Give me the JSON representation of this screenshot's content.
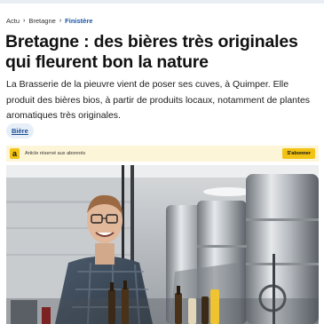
{
  "breadcrumb": {
    "items": [
      "Actu",
      "Bretagne",
      "Finistère"
    ]
  },
  "article": {
    "title": "Bretagne : des bières très originales qui fleurent bon la nature",
    "chapo": "La Brasserie de la pieuvre vient de poser ses cuves, à Quimper. Elle produit des bières bios, à partir de produits locaux, notamment de plantes aromatiques très originales.",
    "tag": "Bière"
  },
  "premium": {
    "logo_letter": "a",
    "notice": "Article réservé aux abonnés",
    "subscribe_label": "S'abonner"
  },
  "colors": {
    "accent_blue": "#1a55a8",
    "premium_yellow": "#f2c314",
    "premium_bg": "#fdf5d8",
    "tag_bg": "#e6eef8"
  },
  "icons": {
    "breadcrumb_separator": "chevron-right-icon"
  }
}
